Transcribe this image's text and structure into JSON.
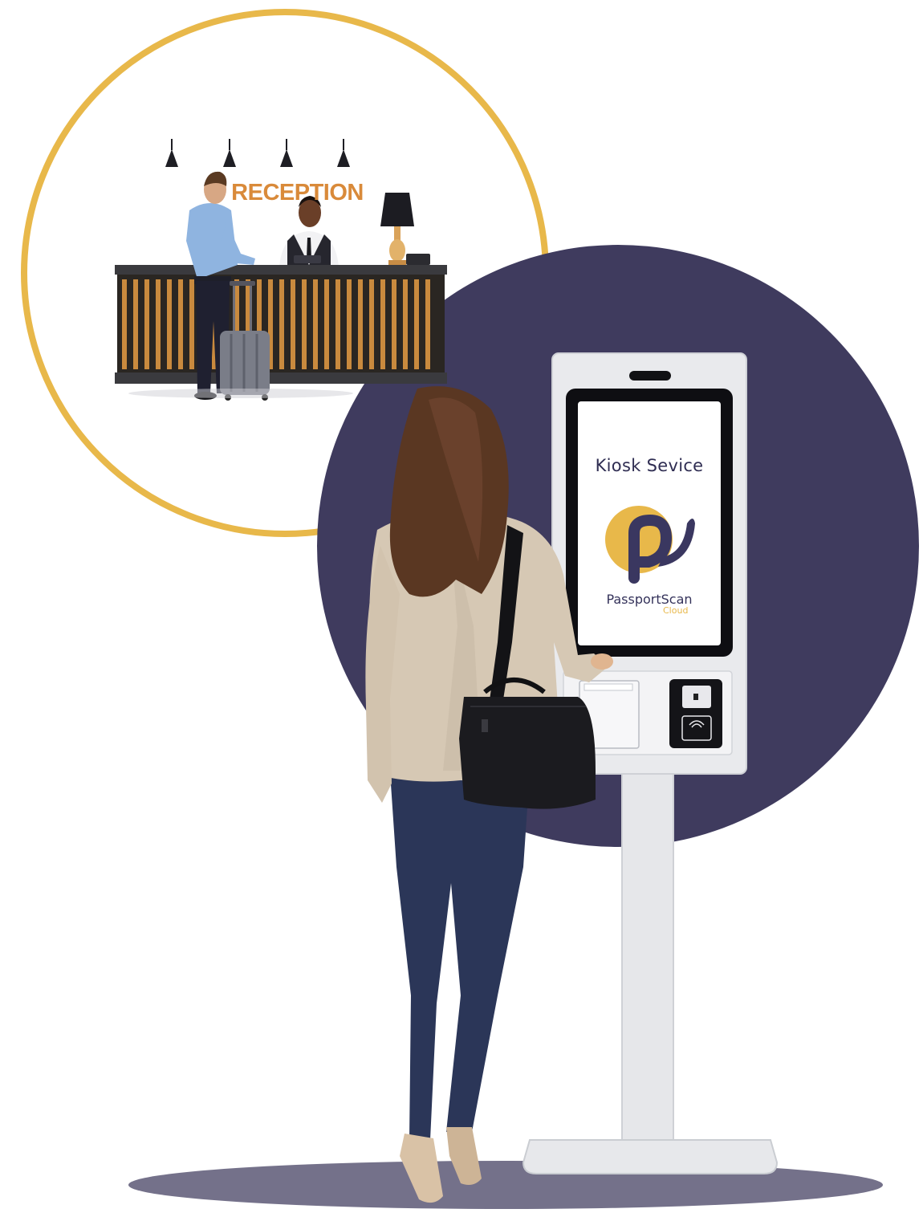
{
  "colors": {
    "ring": "#e8b84a",
    "disc": "#3f3b5e",
    "brand_dark": "#34325a",
    "brand_gold": "#e8b84a"
  },
  "reception": {
    "sign_text": "RECEPTION"
  },
  "kiosk": {
    "screen_title": "Kiosk Sevice",
    "logo_icon": "passportscan-logo-icon",
    "brand_name": "PassportScan",
    "brand_sub": "Cloud"
  }
}
